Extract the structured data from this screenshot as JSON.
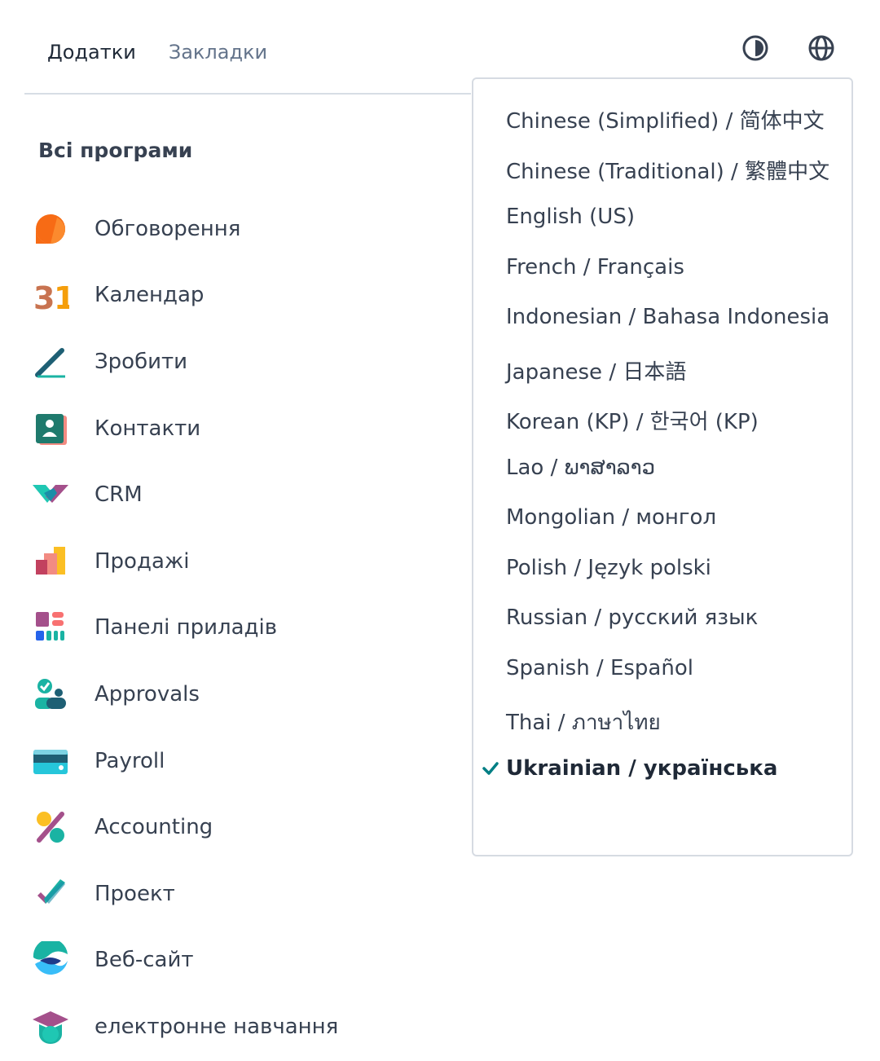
{
  "nav": {
    "tabs": [
      {
        "label": "Додатки"
      },
      {
        "label": "Закладки"
      }
    ]
  },
  "header_icons": [
    "theme-toggle-icon",
    "globe-icon"
  ],
  "section_title": "Всі програми",
  "apps": [
    {
      "label": "Обговорення",
      "icon": "discuss-icon"
    },
    {
      "label": "Календар",
      "icon": "calendar-icon"
    },
    {
      "label": "Зробити",
      "icon": "todo-icon"
    },
    {
      "label": "Контакти",
      "icon": "contacts-icon"
    },
    {
      "label": "CRM",
      "icon": "crm-icon"
    },
    {
      "label": "Продажі",
      "icon": "sales-icon"
    },
    {
      "label": "Панелі приладів",
      "icon": "dashboards-icon"
    },
    {
      "label": "Approvals",
      "icon": "approvals-icon"
    },
    {
      "label": "Payroll",
      "icon": "payroll-icon"
    },
    {
      "label": "Accounting",
      "icon": "accounting-icon"
    },
    {
      "label": "Проект",
      "icon": "project-icon"
    },
    {
      "label": "Веб-сайт",
      "icon": "website-icon"
    },
    {
      "label": "електронне навчання",
      "icon": "elearning-icon"
    }
  ],
  "calendar_day": "31",
  "languages": [
    {
      "label": "Chinese (Simplified) / 简体中文"
    },
    {
      "label": "Chinese (Traditional) / 繁體中文"
    },
    {
      "label": "English (US)"
    },
    {
      "label": "French / Français"
    },
    {
      "label": "Indonesian / Bahasa Indonesia"
    },
    {
      "label": "Japanese / 日本語"
    },
    {
      "label": "Korean (KP) / 한국어 (KP)"
    },
    {
      "label": "Lao / ພາສາລາວ"
    },
    {
      "label": "Mongolian / монгол"
    },
    {
      "label": "Polish / Język polski"
    },
    {
      "label": "Russian / русский язык"
    },
    {
      "label": "Spanish / Español"
    },
    {
      "label": "Thai / ภาษาไทย"
    },
    {
      "label": "Ukrainian / українська",
      "selected": true
    }
  ],
  "colors": {
    "accent": "#017e84",
    "text": "#374151",
    "muted": "#64748b"
  }
}
